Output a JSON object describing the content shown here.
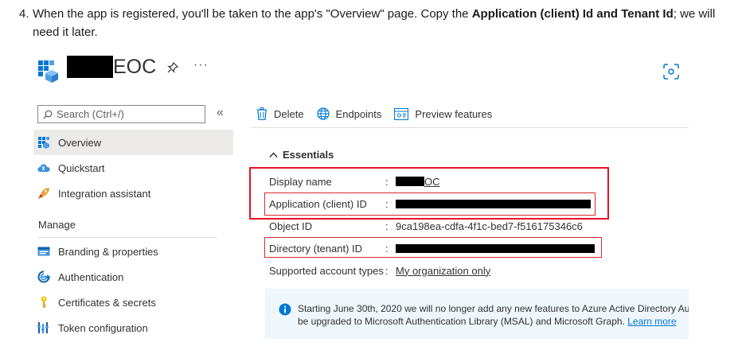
{
  "instructions": {
    "number": "4.",
    "part1": "When the app is registered, you'll be taken to the app's \"Overview\" page. Copy the ",
    "bold": "Application (client) Id and Tenant Id",
    "part2": "; we will need it later."
  },
  "header": {
    "app_name_suffix": "EOC",
    "more_label": "···"
  },
  "sidebar": {
    "search_placeholder": "Search (Ctrl+/)",
    "collapse_label": "«",
    "items": [
      {
        "label": "Overview",
        "icon": "grid-icon",
        "active": true
      },
      {
        "label": "Quickstart",
        "icon": "cloud-icon"
      },
      {
        "label": "Integration assistant",
        "icon": "rocket-icon"
      }
    ],
    "section_title": "Manage",
    "manage_items": [
      {
        "label": "Branding & properties",
        "icon": "branding-icon"
      },
      {
        "label": "Authentication",
        "icon": "auth-icon"
      },
      {
        "label": "Certificates & secrets",
        "icon": "key-icon"
      },
      {
        "label": "Token configuration",
        "icon": "token-icon"
      }
    ]
  },
  "toolbar": {
    "delete_label": "Delete",
    "endpoints_label": "Endpoints",
    "preview_label": "Preview features"
  },
  "essentials": {
    "title": "Essentials",
    "colon": ":",
    "display_name_label": "Display name",
    "display_name_suffix": "OC",
    "app_id_label": "Application (client) ID",
    "object_id_label": "Object ID",
    "object_id_value": "9ca198ea-cdfa-4f1c-bed7-f516175346c6",
    "tenant_id_label": "Directory (tenant) ID",
    "supported_label": "Supported account types",
    "supported_value": "My organization only"
  },
  "info_banner": {
    "line1": "Starting June 30th, 2020 we will no longer add any new features to Azure Active Directory Au",
    "line2": "be upgraded to Microsoft Authentication Library (MSAL) and Microsoft Graph.",
    "link": "Learn more"
  },
  "colors": {
    "accent": "#0078d4",
    "highlight": "#e81123",
    "redaction": "#000000"
  }
}
